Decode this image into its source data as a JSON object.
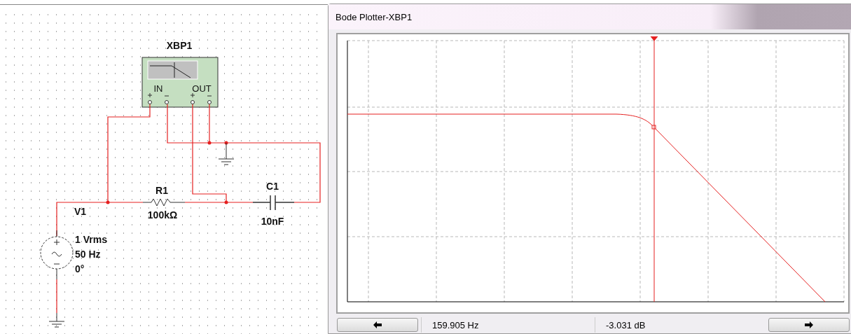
{
  "schematic": {
    "instrument": {
      "label": "XBP1",
      "input": "IN",
      "output": "OUT"
    },
    "components": [
      {
        "kind": "resistor",
        "name": "R1",
        "value": "100kΩ"
      },
      {
        "kind": "capacitor",
        "name": "C1",
        "value": "10nF"
      },
      {
        "kind": "source",
        "name": "V1",
        "lines": [
          "1 Vrms",
          "50 Hz",
          "0°"
        ]
      }
    ]
  },
  "plotter": {
    "title": "Bode Plotter-XBP1",
    "frequency": "159.905 Hz",
    "gain": "-3.031 dB"
  }
}
